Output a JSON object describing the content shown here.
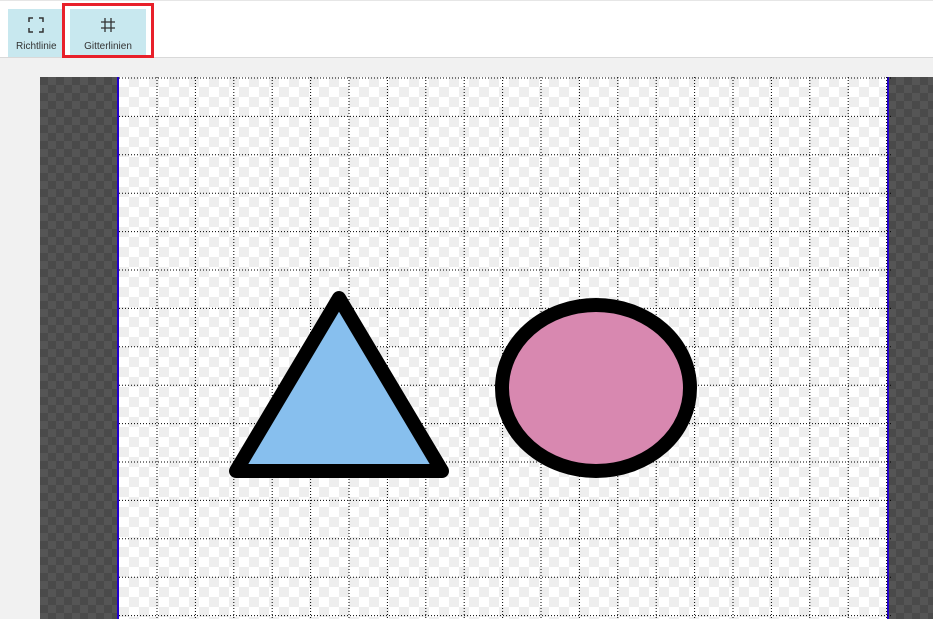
{
  "toolbar": {
    "guides_label": "Richtlinie",
    "grid_label": "Gitterlinien",
    "guides_icon": "guides-corners-icon",
    "grid_icon": "grid-hash-icon"
  },
  "canvas": {
    "shapes": [
      {
        "type": "triangle",
        "fill": "#87bfee",
        "stroke": "#000000"
      },
      {
        "type": "circle",
        "fill": "#d888b0",
        "stroke": "#000000"
      }
    ],
    "grid_visible": true,
    "border_color": "#2200cc"
  }
}
